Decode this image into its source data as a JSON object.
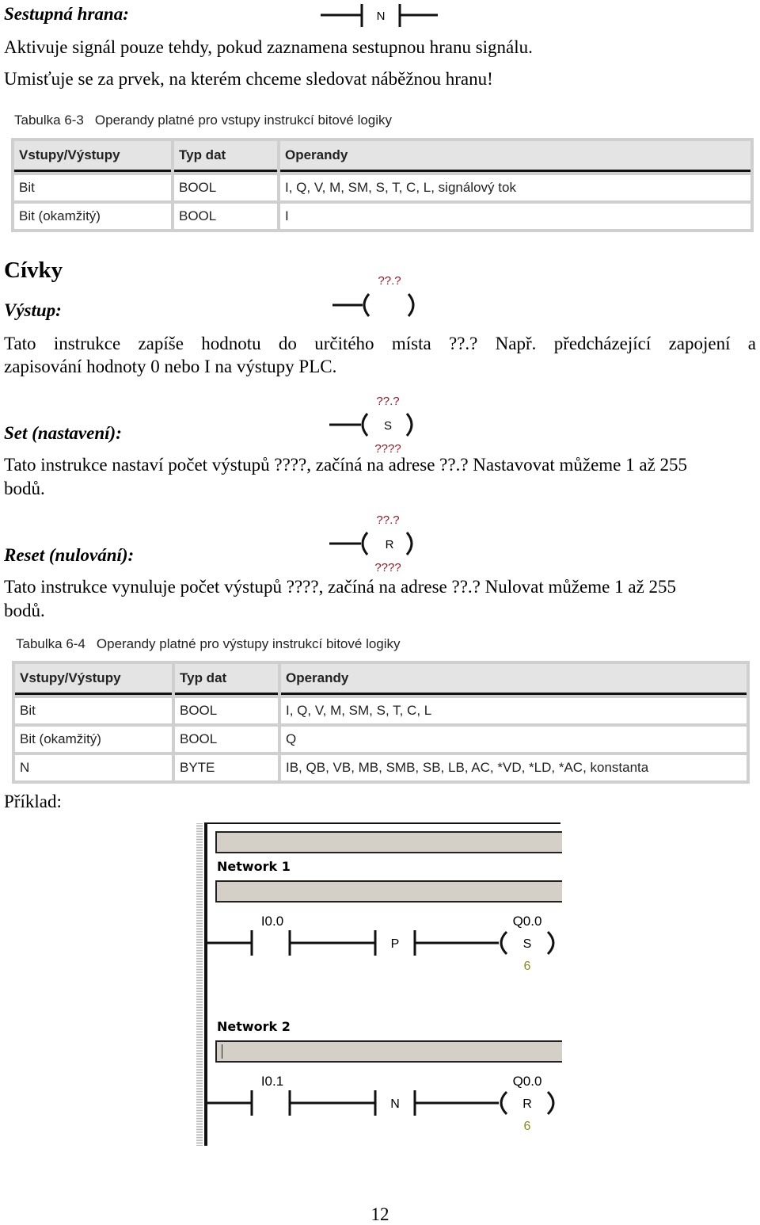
{
  "falling_edge": {
    "title": "Sestupná hrana:",
    "symbol_label": "N",
    "line1": "Aktivuje signál pouze tehdy, pokud zaznamena sestupnou hranu signálu.",
    "line2": "Umisťuje se za prvek, na kterém chceme sledovat náběžnou hranu!"
  },
  "table1": {
    "caption_num": "Tabulka 6-3",
    "caption_text": "Operandy platné pro vstupy instrukcí bitové logiky",
    "headers": [
      "Vstupy/Výstupy",
      "Typ dat",
      "Operandy"
    ],
    "rows": [
      [
        "Bit",
        "BOOL",
        "I, Q, V, M, SM, S, T, C, L, signálový tok"
      ],
      [
        "Bit (okamžitý)",
        "BOOL",
        "I"
      ]
    ]
  },
  "coils": {
    "heading": "Cívky",
    "output": {
      "title": "Výstup:",
      "symbol_address": "??.?",
      "para_line1": "Tato instrukce zapíše hodnotu do určitého místa ??.? Např. předcházející zapojení a",
      "para_line2": "zapisování hodnoty 0 nebo I na výstupy PLC."
    },
    "set": {
      "title": "Set (nastavení):",
      "symbol_address": "??.?",
      "symbol_letter": "S",
      "symbol_count": "????",
      "para_line1": "Tato instrukce nastaví počet výstupů ????, začíná na adrese ??.? Nastavovat můžeme 1 až 255",
      "para_line2": "bodů."
    },
    "reset": {
      "title": "Reset (nulování):",
      "symbol_address": "??.?",
      "symbol_letter": "R",
      "symbol_count": "????",
      "para_line1": "Tato instrukce vynuluje počet výstupů ????, začíná na adrese ??.? Nulovat můžeme 1 až 255",
      "para_line2": "bodů."
    }
  },
  "table2": {
    "caption_num": "Tabulka 6-4",
    "caption_text": "Operandy platné pro výstupy instrukcí bitové logiky",
    "headers": [
      "Vstupy/Výstupy",
      "Typ dat",
      "Operandy"
    ],
    "rows": [
      [
        "Bit",
        "BOOL",
        "I, Q, V, M, SM, S, T, C, L"
      ],
      [
        "Bit (okamžitý)",
        "BOOL",
        "Q"
      ],
      [
        "N",
        "BYTE",
        "IB, QB, VB, MB, SMB, SB, LB, AC, *VD, *LD, *AC, konstanta"
      ]
    ]
  },
  "example": {
    "label": "Příklad:",
    "networks": [
      {
        "title": "Network 1",
        "contact_address": "I0.0",
        "edge_label": "P",
        "coil_address": "Q0.0",
        "coil_letter": "S",
        "coil_count": "6"
      },
      {
        "title": "Network 2",
        "contact_address": "I0.1",
        "edge_label": "N",
        "coil_address": "Q0.0",
        "coil_letter": "R",
        "coil_count": "6"
      }
    ]
  },
  "page_number": "12",
  "colors": {
    "placeholder_red": "#a0141e",
    "count_olive": "#8a8a1e",
    "comment_bar": "#d4d0c8",
    "table_border": "#cfcfcf",
    "table_header": "#e4e4e4"
  }
}
